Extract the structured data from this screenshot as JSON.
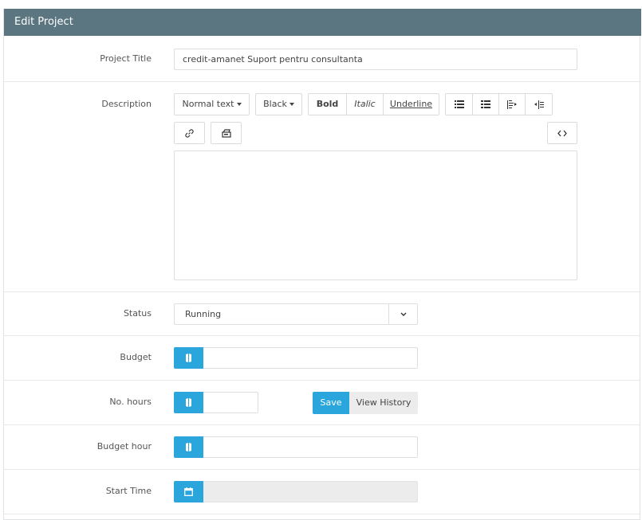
{
  "panel": {
    "title": "Edit Project"
  },
  "fields": {
    "project_title": {
      "label": "Project Title",
      "value": "credit-amanet Suport pentru consultanta"
    },
    "description": {
      "label": "Description",
      "toolbar": {
        "format": "Normal text",
        "color": "Black",
        "bold": "Bold",
        "italic": "Italic",
        "underline": "Underline"
      },
      "value": ""
    },
    "status": {
      "label": "Status",
      "value": "Running"
    },
    "budget": {
      "label": "Budget",
      "value": ""
    },
    "hours": {
      "label": "No. hours",
      "value": "",
      "save": "Save",
      "history": "View History"
    },
    "budget_hour": {
      "label": "Budget hour",
      "value": ""
    },
    "start_time": {
      "label": "Start Time",
      "value": ""
    }
  },
  "colors": {
    "header_bg": "#5b7581",
    "accent": "#2aa6dd",
    "disabled_bg": "#ececec"
  },
  "icons": [
    "unordered-list-icon",
    "ordered-list-icon",
    "outdent-icon",
    "indent-icon",
    "link-icon",
    "image-icon",
    "code-icon",
    "money-icon",
    "calendar-icon",
    "chevron-down-icon"
  ]
}
